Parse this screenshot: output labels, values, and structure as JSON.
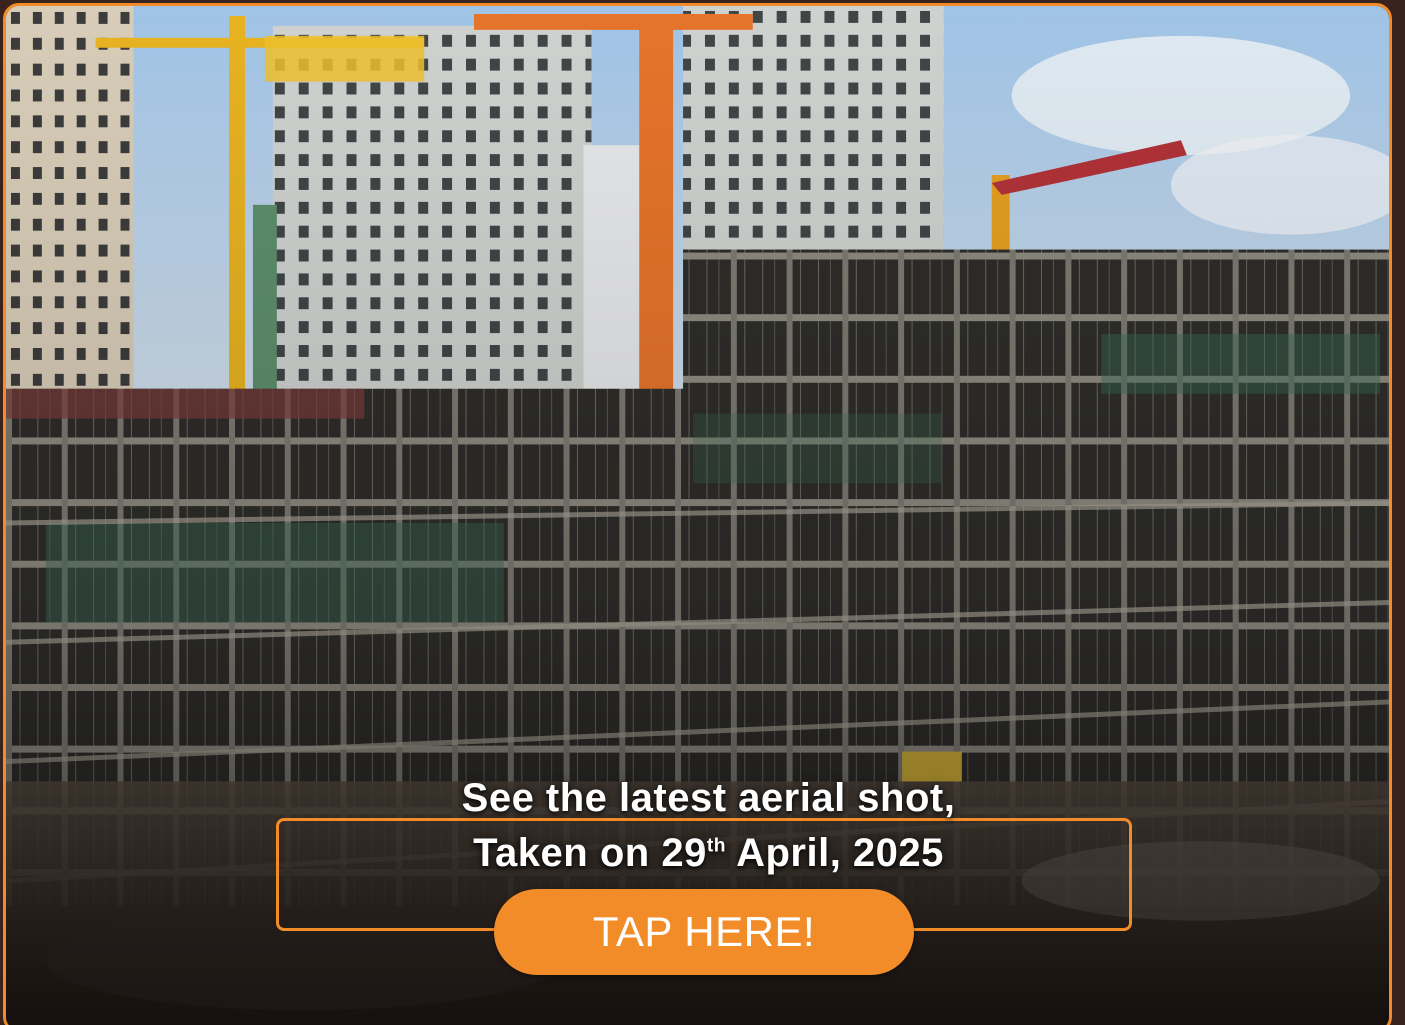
{
  "banner": {
    "line1": "See the latest aerial shot,",
    "line2_prefix": "Taken on 29",
    "line2_sup": "th",
    "line2_suffix": " April, 2025",
    "cta_label": "TAP HERE!"
  },
  "colors": {
    "accent": "#f28c28",
    "background": "#3a231c",
    "text": "#ffffff"
  }
}
